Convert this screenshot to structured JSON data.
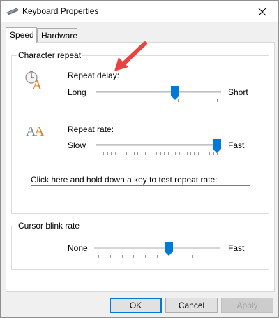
{
  "window": {
    "title": "Keyboard Properties",
    "title_icon": "keyboard-icon"
  },
  "tabs": [
    {
      "label": "Speed",
      "active": true
    },
    {
      "label": "Hardware",
      "active": false
    }
  ],
  "character_repeat": {
    "group_title": "Character repeat",
    "repeat_delay": {
      "label": "Repeat delay:",
      "left_label": "Long",
      "right_label": "Short",
      "value_fraction": 0.64,
      "icon": "stopwatch-letter-a-icon"
    },
    "repeat_rate": {
      "label": "Repeat rate:",
      "left_label": "Slow",
      "right_label": "Fast",
      "value_fraction": 1.0,
      "icon": "double-letter-a-icon"
    },
    "test_label": "Click here and hold down a key to test repeat rate:",
    "test_value": ""
  },
  "cursor_blink": {
    "group_title": "Cursor blink rate",
    "left_label": "None",
    "right_label": "Fast",
    "value_fraction": 0.6
  },
  "buttons": {
    "ok": "OK",
    "cancel": "Cancel",
    "apply": "Apply"
  },
  "colors": {
    "accent": "#0078d7",
    "annotation_arrow": "#e8433f"
  }
}
